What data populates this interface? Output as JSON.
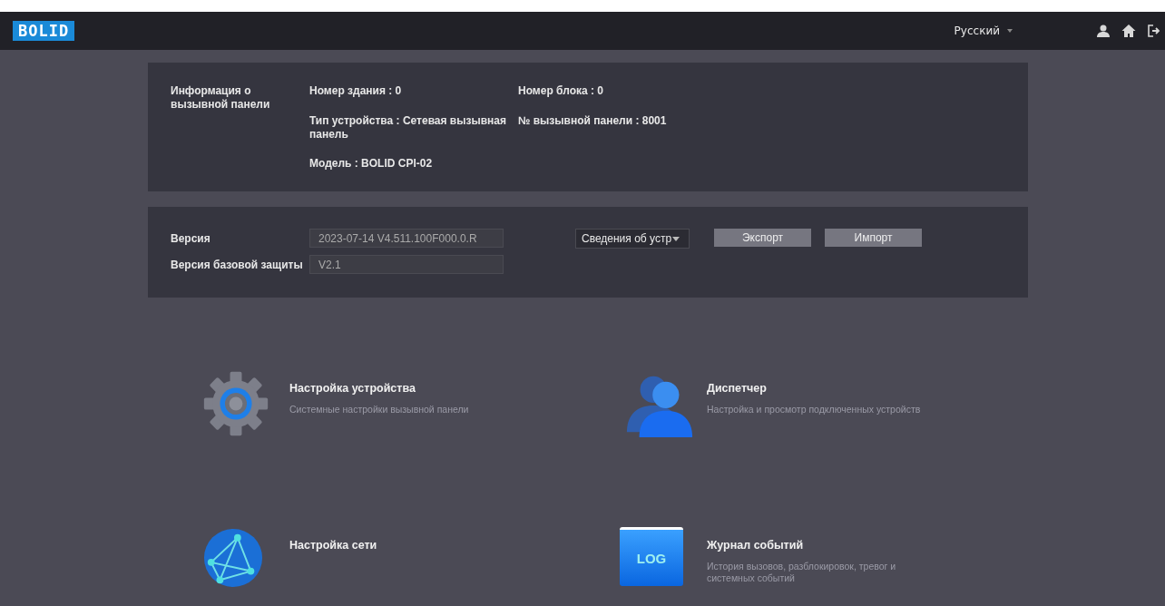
{
  "header": {
    "logo": "BOLID",
    "language": "Русский"
  },
  "info": {
    "title": "Информация о вызывной панели",
    "fields": [
      {
        "label": "Номер здания :",
        "value": "0"
      },
      {
        "label": "Номер блока :",
        "value": "0"
      },
      {
        "label": "Тип устройства :",
        "value": "Сетевая вызывная панель"
      },
      {
        "label": "№ вызывной панели :",
        "value": "8001"
      },
      {
        "label": "Модель :",
        "value": "BOLID CPI-02"
      }
    ]
  },
  "version": {
    "rows": [
      {
        "label": "Версия",
        "value": "2023-07-14 V4.511.100F000.0.R"
      },
      {
        "label": "Версия базовой защиты",
        "value": "V2.1"
      }
    ],
    "dropdown": "Сведения об устр",
    "buttons": [
      "Экспорт",
      "Импорт"
    ]
  },
  "tiles": [
    {
      "kind": "gear",
      "title": "Настройка устройства",
      "description": "Системные настройки вызывной панели"
    },
    {
      "kind": "users",
      "title": "Диспетчер",
      "description": "Настройка и просмотр подключенных устройств"
    },
    {
      "kind": "globe",
      "title": "Настройка сети"
    },
    {
      "kind": "log",
      "icon_text": "LOG",
      "title": "Журнал событий",
      "description": "История вызовов, разблокировок, тревог и системных событий"
    }
  ]
}
